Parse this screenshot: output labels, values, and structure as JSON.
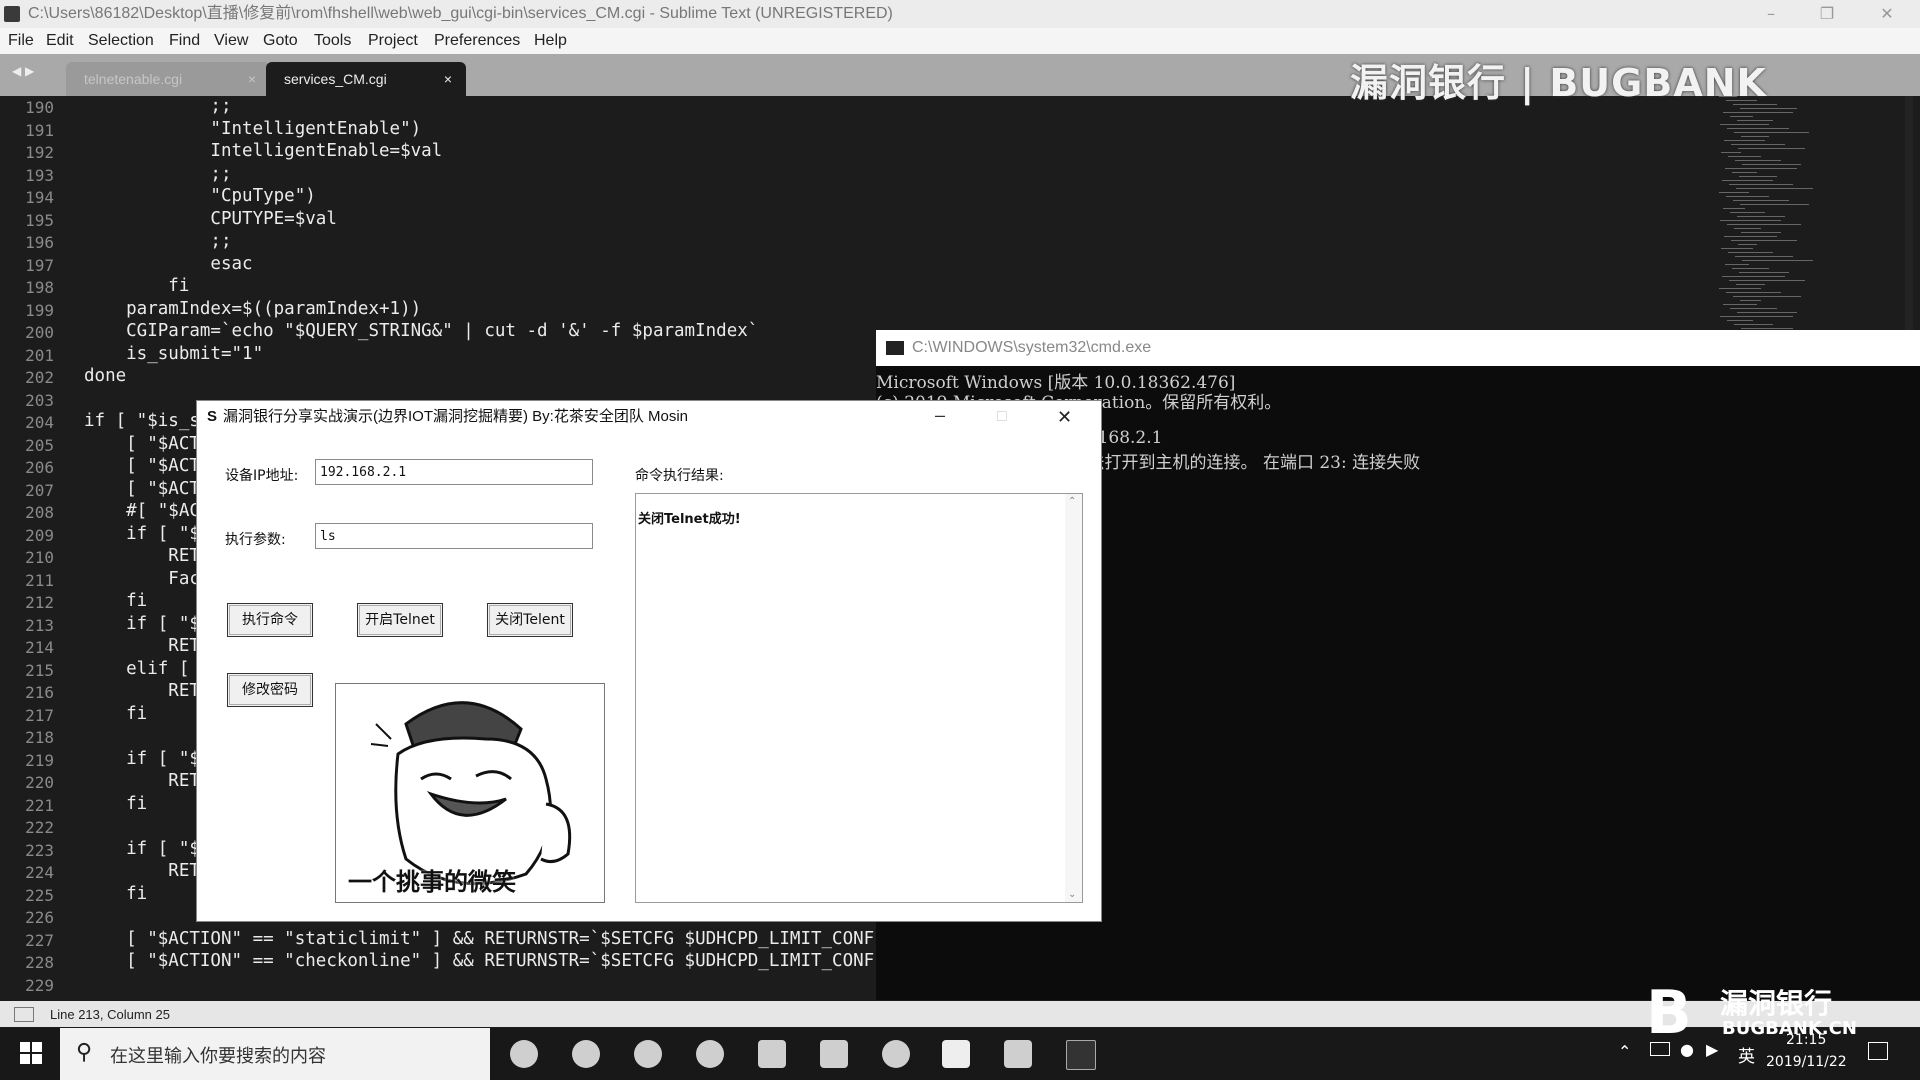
{
  "sublime": {
    "window_title": "C:\\Users\\86182\\Desktop\\直播\\修复前\\rom\\fhshell\\web\\web_gui\\cgi-bin\\services_CM.cgi - Sublime Text (UNREGISTERED)",
    "menu": [
      "File",
      "Edit",
      "Selection",
      "Find",
      "View",
      "Goto",
      "Tools",
      "Project",
      "Preferences",
      "Help"
    ],
    "tabs": [
      {
        "label": "telnetenable.cgi"
      },
      {
        "label": "services_CM.cgi"
      }
    ],
    "tab_close_glyph": "×",
    "watermark": "漏洞银行 | BUGBANK",
    "status": "Line 213, Column 25",
    "line_numbers": [
      "190",
      "191",
      "192",
      "193",
      "194",
      "195",
      "196",
      "197",
      "198",
      "199",
      "200",
      "201",
      "202",
      "203",
      "204",
      "205",
      "206",
      "207",
      "208",
      "209",
      "210",
      "211",
      "212",
      "213",
      "214",
      "215",
      "216",
      "217",
      "218",
      "219",
      "220",
      "221",
      "222",
      "223",
      "224",
      "225",
      "226",
      "227",
      "228",
      "229"
    ],
    "code_lines": [
      "            ;;",
      "            \"IntelligentEnable\")",
      "            IntelligentEnable=$val",
      "            ;;",
      "            \"CpuType\")",
      "            CPUTYPE=$val",
      "            ;;",
      "            esac",
      "        fi",
      "    paramIndex=$((paramIndex+1))",
      "    CGIParam=`echo \"$QUERY_STRING&\" | cut -d '&' -f $paramIndex`",
      "    is_submit=\"1\"",
      "done",
      "",
      "if [ \"$is_s",
      "    [ \"$ACT",
      "    [ \"$ACT",
      "    [ \"$ACT",
      "    #[ \"$AC",
      "    if [ \"$",
      "        RET",
      "        Fac",
      "    fi",
      "    if [ \"$",
      "        RET",
      "    elif [",
      "        RET",
      "    fi",
      "",
      "    if [ \"$",
      "        RET",
      "    fi",
      "",
      "    if [ \"$",
      "        RET",
      "    fi",
      "",
      "    [ \"$ACTION\" == \"staticlimit\" ] && RETURNSTR=`$SETCFG $UDHCPD_LIMIT_CONF S",
      "    [ \"$ACTION\" == \"checkonline\" ] && RETURNSTR=`$SETCFG $UDHCPD_LIMIT_CONF C",
      ""
    ]
  },
  "cmd": {
    "title": "C:\\WINDOWS\\system32\\cmd.exe",
    "lines": [
      "Microsoft Windows [版本 10.0.18362.476]",
      "(c) 2019 Microsoft Corporation。保留所有权利。",
      "",
      "                                    92.168.2.1",
      "                                    无法打开到主机的连接。 在端口 23: 连接失败"
    ]
  },
  "tool": {
    "title": "漏洞银行分享实战演示(边界IOT漏洞挖掘精要)   By:花茶安全团队  Mosin",
    "title_icon": "S",
    "ip_label": "设备IP地址:",
    "ip_value": "192.168.2.1",
    "param_label": "执行参数:",
    "param_value": "ls",
    "result_label": "命令执行结果:",
    "result_text": "关闭Telnet成功!",
    "buttons": {
      "exec": "执行命令",
      "open_telnet": "开启Telnet",
      "close_telnet": "关闭Telent",
      "change_pwd": "修改密码"
    },
    "meme_caption": "一个挑事的微笑"
  },
  "taskbar": {
    "search_placeholder": "在这里输入你要搜索的内容",
    "ime": "英",
    "time": "21:15",
    "date": "2019/11/22"
  },
  "brand": {
    "name": "漏洞银行",
    "domain": "BUGBANK.CN"
  }
}
